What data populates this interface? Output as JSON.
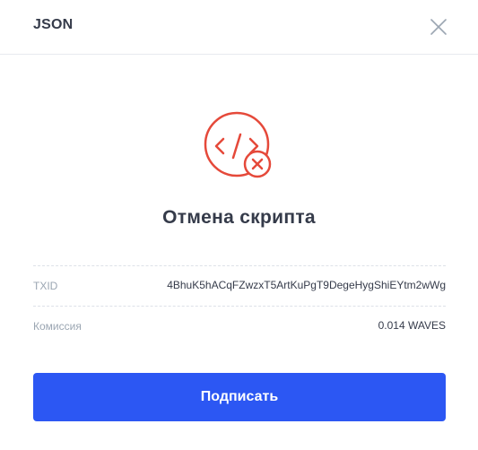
{
  "header": {
    "title": "JSON"
  },
  "icons": {
    "close": "close-icon",
    "transaction": "script-cancel-icon",
    "accent_color": "#e5493a"
  },
  "transaction": {
    "title": "Отмена скрипта"
  },
  "details": [
    {
      "label": "TXID",
      "value": "4BhuK5hACqFZwzxT5ArtKuPgT9DegeHygShiEYtm2wWg"
    },
    {
      "label": "Комиссия",
      "value": "0.014 WAVES"
    }
  ],
  "actions": {
    "sign_label": "Подписать",
    "button_color": "#2c57f3"
  }
}
